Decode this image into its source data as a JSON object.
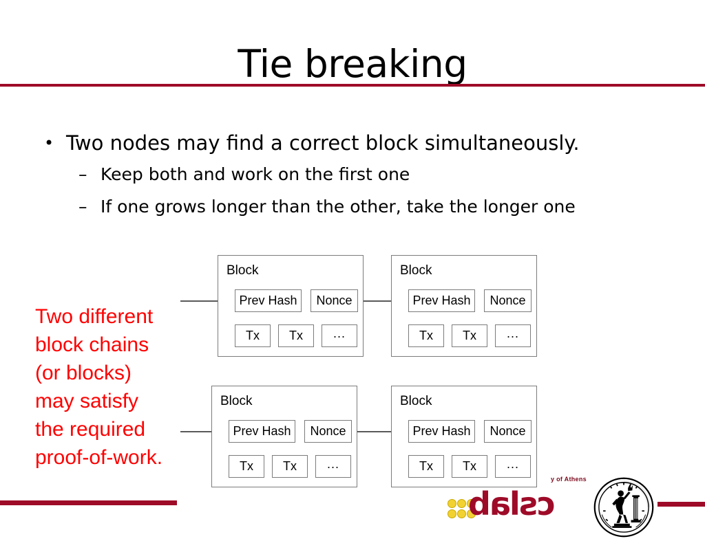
{
  "slide": {
    "title": "Tie breaking",
    "accent_color": "#9E0B28",
    "annotation_color": "#FF0000"
  },
  "bullets": [
    {
      "marker": "•",
      "level": 1,
      "text": "Two nodes may find a correct block simultaneously."
    },
    {
      "marker": "–",
      "level": 2,
      "text": "Keep both and work on the first one"
    },
    {
      "marker": "–",
      "level": 2,
      "text": "If one grows longer than the other, take the longer one"
    }
  ],
  "annotation": {
    "lines": [
      "Two different",
      "block chains",
      "(or blocks)",
      "may satisfy",
      "the required",
      "proof-of-work."
    ]
  },
  "diagram": {
    "blocks": [
      {
        "id": "r1c1",
        "label": "Block",
        "prev_hash": "Prev Hash",
        "nonce": "Nonce",
        "tx1": "Tx",
        "tx2": "Tx",
        "tx_more": "..."
      },
      {
        "id": "r1c2",
        "label": "Block",
        "prev_hash": "Prev Hash",
        "nonce": "Nonce",
        "tx1": "Tx",
        "tx2": "Tx",
        "tx_more": "..."
      },
      {
        "id": "r2c1",
        "label": "Block",
        "prev_hash": "Prev Hash",
        "nonce": "Nonce",
        "tx1": "Tx",
        "tx2": "Tx",
        "tx_more": "..."
      },
      {
        "id": "r2c2",
        "label": "Block",
        "prev_hash": "Prev Hash",
        "nonce": "Nonce",
        "tx1": "Tx",
        "tx2": "Tx",
        "tx_more": "..."
      }
    ]
  },
  "footer": {
    "university_text": "y of Athens",
    "lab_wordmark": "cslab",
    "seal_name": "ntua-seal"
  }
}
